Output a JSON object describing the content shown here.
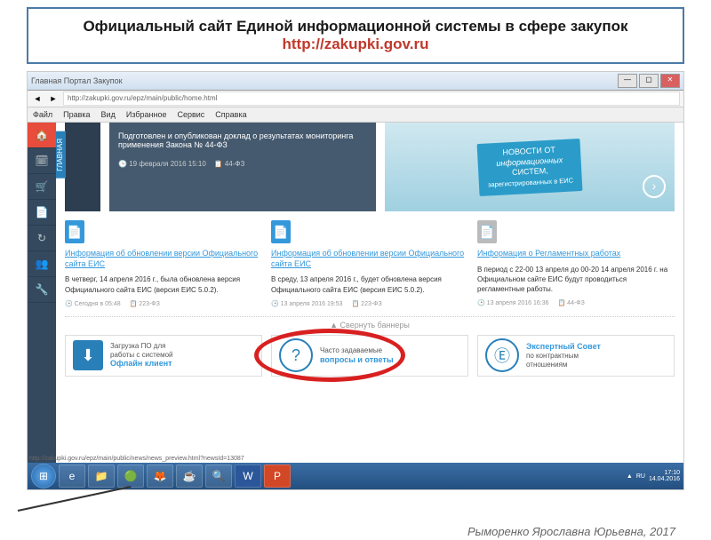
{
  "header": {
    "title": "Официальный сайт Единой информационной системы в сфере закупок",
    "url": "http://zakupki.gov.ru"
  },
  "browser": {
    "window_title": "Главная Портал Закупок",
    "address": "http://zakupki.gov.ru/epz/main/public/home.html",
    "menu": [
      "Файл",
      "Правка",
      "Вид",
      "Избранное",
      "Сервис",
      "Справка"
    ],
    "status_url": "http://zakupki.gov.ru/epz/main/public/news/news_preview.html?newsId=13087"
  },
  "sidebar_tab": "ГЛАВНАЯ",
  "news_banner": {
    "text": "Подготовлен и опубликован доклад о результатах мониторинга применения Закона № 44-ФЗ",
    "date": "19 февраля 2016 15:10",
    "tag": "44-ФЗ"
  },
  "promo": {
    "line1": "НОВОСТИ ОТ",
    "line2": "информационных",
    "line3": "СИСТЕМ,",
    "line4": "зарегистрированных в ЕИС"
  },
  "articles": [
    {
      "title": "Информация об обновлении версии Официального сайта ЕИС",
      "text": "В четверг, 14 апреля 2016 г., была обновлена версия Официального сайта ЕИС (версия ЕИС 5.0.2).",
      "date": "Сегодня в 05:48",
      "tag": "223-ФЗ"
    },
    {
      "title": "Информация об обновлении версии Официального сайта ЕИС",
      "text": "В среду, 13 апреля 2016 г., будет обновлена версия Официального сайта ЕИС (версия ЕИС 5.0.2).",
      "date": "13 апреля 2016 19:53",
      "tag": "223-ФЗ"
    },
    {
      "title": "Информация о Регламентных работах",
      "text": "В период с 22-00 13 апреля до 00-20 14 апреля 2016 г. на Официальном сайте ЕИС будут проводиться регламентные работы.",
      "date": "13 апреля 2016 16:36",
      "tag": "44-ФЗ"
    }
  ],
  "collapse_label": "Свернуть баннеры",
  "banners": [
    {
      "line1": "Загрузка ПО для",
      "line2": "работы с системой",
      "cta": "Офлайн клиент"
    },
    {
      "line1": "Часто задаваемые",
      "cta": "вопросы и ответы"
    },
    {
      "line1": "Экспертный Совет",
      "line2": "по контрактным",
      "line3": "отношениям"
    }
  ],
  "taskbar": {
    "time": "17:10",
    "date": "14.04.2016"
  },
  "footer_credit": "Рыморенко Ярославна Юрьевна, 2017"
}
